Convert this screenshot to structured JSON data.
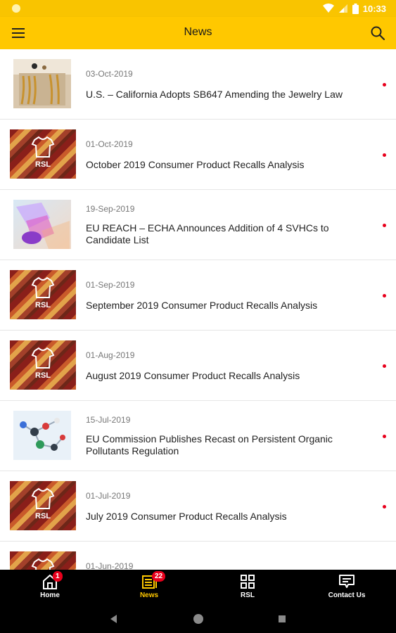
{
  "status": {
    "time": "10:33"
  },
  "appbar": {
    "title": "News"
  },
  "news": [
    {
      "date": "03-Oct-2019",
      "title": "U.S. – California Adopts SB647 Amending the Jewelry Law"
    },
    {
      "date": "01-Oct-2019",
      "title": "October 2019 Consumer Product Recalls Analysis"
    },
    {
      "date": "19-Sep-2019",
      "title": "EU REACH – ECHA Announces Addition of 4 SVHCs to Candidate List"
    },
    {
      "date": "01-Sep-2019",
      "title": "September 2019 Consumer Product Recalls Analysis"
    },
    {
      "date": "01-Aug-2019",
      "title": "August 2019 Consumer Product Recalls Analysis"
    },
    {
      "date": "15-Jul-2019",
      "title": "EU Commission Publishes Recast on Persistent Organic Pollutants Regulation"
    },
    {
      "date": "01-Jul-2019",
      "title": "July 2019 Consumer Product Recalls Analysis"
    },
    {
      "date": "01-Jun-2019",
      "title": ""
    }
  ],
  "thumb_label": "RSL",
  "bottom_nav": [
    {
      "label": "Home",
      "badge": "1"
    },
    {
      "label": "News",
      "badge": "22"
    },
    {
      "label": "RSL"
    },
    {
      "label": "Contact Us"
    }
  ],
  "colors": {
    "brand": "#ffc800",
    "badge": "#e8001c",
    "active_nav": "#ffc800"
  }
}
